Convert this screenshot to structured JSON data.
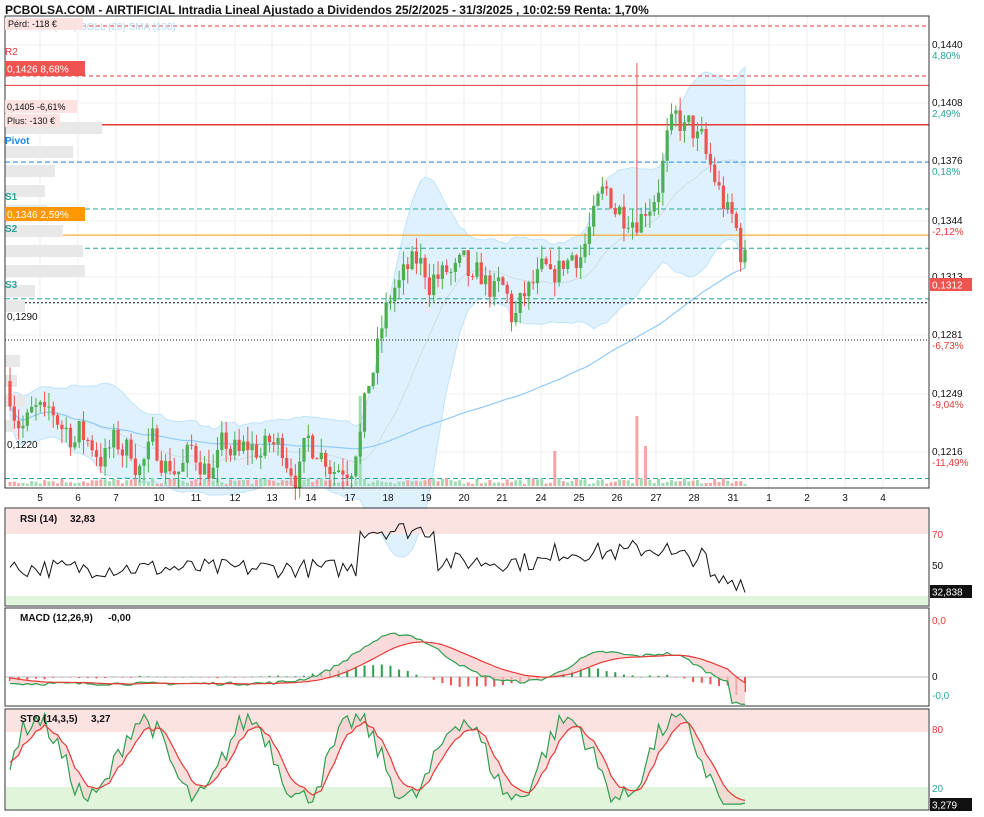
{
  "header": {
    "title": "PCBOLSA.COM - AIRTIFICIAL Intradia Lineal Ajustado a Dividendos 25/2/2025 - 31/3/2025 , 10:02:59 Renta: 1,70%",
    "legend_faded": "SMA (100)  BOLL (20)  SMA (100)"
  },
  "colors": {
    "up": "#4caf50",
    "down": "#ef5350",
    "boll": "#bfe3fb",
    "sma": "#90caf9",
    "resistance": "#e53935",
    "support": "#26a69a",
    "pivot": "#1e88e5",
    "orange": "#ff9800"
  },
  "levels": {
    "perd": {
      "label": "Pérd: -118 €"
    },
    "r2": {
      "label": "R2",
      "value": 0.1431
    },
    "price_1426": {
      "label": "0,1426  8,68%",
      "value": 0.1426
    },
    "price_1405": {
      "label": "0,1405  -6,61%",
      "value": 0.1405
    },
    "plus": {
      "label": "Plus: -130 €"
    },
    "pivot": {
      "label": "Pivot",
      "value": 0.1385
    },
    "s1": {
      "label": "S1",
      "value": 0.136
    },
    "price_1346": {
      "label": "0,1346  2,59%",
      "value": 0.1346
    },
    "s2": {
      "label": "S2",
      "value": 0.1339
    },
    "s3": {
      "label": "S3",
      "value": 0.1312
    },
    "line_1290": {
      "label": "0,1290",
      "value": 0.129
    },
    "line_1220": {
      "label": "0,1220",
      "value": 0.1216
    },
    "last": {
      "label": "0,1312",
      "value": 0.1312
    }
  },
  "price_axis": [
    {
      "value": "0,1440",
      "pct": "4,80%",
      "color": "#26a69a"
    },
    {
      "value": "0,1408",
      "pct": "2,49%",
      "color": "#26a69a"
    },
    {
      "value": "0,1376",
      "pct": "0,18%",
      "color": "#26a69a"
    },
    {
      "value": "0,1344",
      "pct": "-2,12%",
      "color": "#e53935"
    },
    {
      "value": "0,1313",
      "pct": "",
      "color": "#e53935"
    },
    {
      "value": "0,1281",
      "pct": "-6,73%",
      "color": "#e53935"
    },
    {
      "value": "0,1249",
      "pct": "-9,04%",
      "color": "#e53935"
    },
    {
      "value": "0,1216",
      "pct": "-11,49%",
      "color": "#e53935"
    }
  ],
  "x_axis": [
    "5",
    "6",
    "7",
    "10",
    "11",
    "12",
    "13",
    "14",
    "17",
    "18",
    "19",
    "20",
    "21",
    "24",
    "25",
    "26",
    "27",
    "28",
    "31",
    "1",
    "2",
    "3",
    "4"
  ],
  "rsi": {
    "label": "RSI (14)",
    "value": "32,83",
    "last": "32,838",
    "ticks": [
      "70",
      "50"
    ]
  },
  "macd": {
    "label": "MACD (12,26,9)",
    "value": "-0,00",
    "ticks": [
      "0,0",
      "0",
      "-0,0"
    ]
  },
  "sto": {
    "label": "STO (14,3,5)",
    "value": "3,27",
    "last": "3,279",
    "ticks": [
      "80",
      "20"
    ]
  },
  "chart_data": {
    "type": "candlestick",
    "title": "PCBOLSA.COM - AIRTIFICIAL Intradia Lineal Ajustado a Dividendos 25/2/2025 - 31/3/2025 , 10:02:59 Renta: 1,70%",
    "categories": [
      "5",
      "6",
      "7",
      "10",
      "11",
      "12",
      "13",
      "14",
      "17",
      "18",
      "19",
      "20",
      "21",
      "24",
      "25",
      "26",
      "27",
      "28",
      "31"
    ],
    "close_by_day": [
      0.1245,
      0.124,
      0.1232,
      0.123,
      0.1228,
      0.1228,
      0.1232,
      0.1235,
      0.1235,
      0.1318,
      0.1322,
      0.1315,
      0.1305,
      0.1318,
      0.1348,
      0.136,
      0.1395,
      0.1388,
      0.133
    ],
    "ylim": [
      0.1212,
      0.1462
    ],
    "last_price": 0.1312,
    "rsi_last": 32.838,
    "sto_last": 3.279,
    "macd_last": -0.0
  }
}
